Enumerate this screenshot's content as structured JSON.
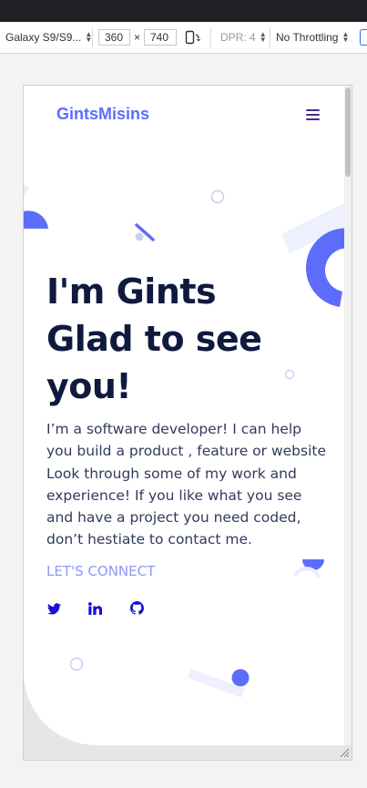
{
  "devtools": {
    "device": "Galaxy S9/S9...",
    "width": "360",
    "times": "×",
    "height": "740",
    "dpr": "DPR: 4",
    "throttling": "No Throttling"
  },
  "site": {
    "logo": "GintsMisins",
    "hero_lines": [
      "I'm Gints",
      "Glad to see",
      "you!"
    ],
    "intro": "I’m a software developer! I can help you build a product , feature or website Look through some of my work and experience! If you like what you see and have a project you need coded, don’t hestiate to contact me.",
    "cta": "LET'S CONNECT",
    "social": [
      "twitter-icon",
      "linkedin-icon",
      "github-icon"
    ]
  },
  "colors": {
    "accent": "#5d6dfb",
    "heading": "#101a3f",
    "text": "#303a5c",
    "cta": "#8f95f7",
    "social_icon": "#1a0dd6"
  }
}
